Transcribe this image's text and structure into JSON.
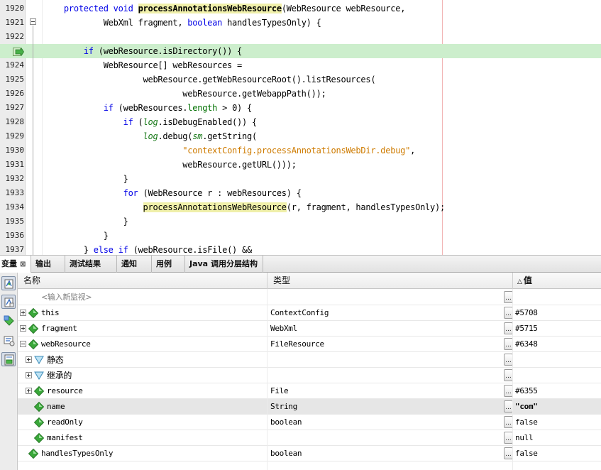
{
  "editor": {
    "lines": [
      {
        "num": "1920",
        "tokens": [
          {
            "t": "    "
          },
          {
            "t": "protected",
            "c": "kw"
          },
          {
            "t": " "
          },
          {
            "t": "void",
            "c": "kw"
          },
          {
            "t": " "
          },
          {
            "t": "processAnnotationsWebResource",
            "c": "mhl bold"
          },
          {
            "t": "(WebResource webResource,"
          }
        ]
      },
      {
        "num": "1921",
        "tokens": [
          {
            "t": "            WebXml fragment, "
          },
          {
            "t": "boolean",
            "c": "kw"
          },
          {
            "t": " handlesTypesOnly) {"
          }
        ]
      },
      {
        "num": "1922",
        "tokens": [
          {
            "t": ""
          }
        ]
      },
      {
        "num": "",
        "tokens": [
          {
            "t": "        "
          },
          {
            "t": "if",
            "c": "kw"
          },
          {
            "t": " (webResource.isDirectory()) {"
          }
        ]
      },
      {
        "num": "1924",
        "tokens": [
          {
            "t": "            WebResource[] webResources ="
          }
        ]
      },
      {
        "num": "1925",
        "tokens": [
          {
            "t": "                    webResource.getWebResourceRoot().listResources("
          }
        ]
      },
      {
        "num": "1926",
        "tokens": [
          {
            "t": "                            webResource.getWebappPath());"
          }
        ]
      },
      {
        "num": "1927",
        "tokens": [
          {
            "t": "            "
          },
          {
            "t": "if",
            "c": "kw"
          },
          {
            "t": " (webResources."
          },
          {
            "t": "length",
            "c": "fld"
          },
          {
            "t": " > 0) {"
          }
        ]
      },
      {
        "num": "1928",
        "tokens": [
          {
            "t": "                "
          },
          {
            "t": "if",
            "c": "kw"
          },
          {
            "t": " ("
          },
          {
            "t": "log",
            "c": "ital"
          },
          {
            "t": ".isDebugEnabled()) {"
          }
        ]
      },
      {
        "num": "1929",
        "tokens": [
          {
            "t": "                    "
          },
          {
            "t": "log",
            "c": "ital"
          },
          {
            "t": ".debug("
          },
          {
            "t": "sm",
            "c": "ital"
          },
          {
            "t": ".getString("
          }
        ]
      },
      {
        "num": "1930",
        "tokens": [
          {
            "t": "                            "
          },
          {
            "t": "\"contextConfig.processAnnotationsWebDir.debug\"",
            "c": "str"
          },
          {
            "t": ","
          }
        ]
      },
      {
        "num": "1931",
        "tokens": [
          {
            "t": "                            webResource.getURL()));"
          }
        ]
      },
      {
        "num": "1932",
        "tokens": [
          {
            "t": "                }"
          }
        ]
      },
      {
        "num": "1933",
        "tokens": [
          {
            "t": "                "
          },
          {
            "t": "for",
            "c": "kw"
          },
          {
            "t": " (WebResource r : webResources) {"
          }
        ]
      },
      {
        "num": "1934",
        "tokens": [
          {
            "t": "                    "
          },
          {
            "t": "processAnnotationsWebResource",
            "c": "mhl"
          },
          {
            "t": "(r, fragment, handlesTypesOnly);"
          }
        ]
      },
      {
        "num": "1935",
        "tokens": [
          {
            "t": "                }"
          }
        ]
      },
      {
        "num": "1936",
        "tokens": [
          {
            "t": "            }"
          }
        ]
      },
      {
        "num": "1937",
        "tokens": [
          {
            "t": "        } "
          },
          {
            "t": "else",
            "c": "kw"
          },
          {
            "t": " "
          },
          {
            "t": "if",
            "c": "kw"
          },
          {
            "t": " (webResource.isFile() &&"
          }
        ]
      }
    ]
  },
  "tabs": [
    {
      "label": "变量",
      "close": "⊠"
    },
    {
      "label": "输出"
    },
    {
      "label": "测试结果"
    },
    {
      "label": "通知"
    },
    {
      "label": "用例"
    },
    {
      "label": "Java 调用分层结构"
    }
  ],
  "table": {
    "columns": {
      "name": "名称",
      "type": "类型",
      "value_arrow": "△",
      "value": "值"
    },
    "watch_placeholder": "<输入新监视>",
    "ellipsis": "...",
    "rows": [
      {
        "name": "this",
        "type": "ContextConfig",
        "value": "#5708"
      },
      {
        "name": "fragment",
        "type": "WebXml",
        "value": "#5715"
      },
      {
        "name": "webResource",
        "type": "FileResource",
        "value": "#6348"
      },
      {
        "name": "静态",
        "type": "",
        "value": ""
      },
      {
        "name": "继承的",
        "type": "",
        "value": ""
      },
      {
        "name": "resource",
        "type": "File",
        "value": "#6355"
      },
      {
        "name": "name",
        "type": "String",
        "value": "\"com\""
      },
      {
        "name": "readOnly",
        "type": "boolean",
        "value": "false"
      },
      {
        "name": "manifest",
        "type": "",
        "value": "null"
      },
      {
        "name": "handlesTypesOnly",
        "type": "boolean",
        "value": "false"
      }
    ]
  },
  "colors": {
    "keyword": "#0000e6",
    "string": "#ce7b00",
    "current_line": "#cceecc",
    "method_highlight": "#f0f0aa",
    "variable_icon": "#3aa83a"
  }
}
